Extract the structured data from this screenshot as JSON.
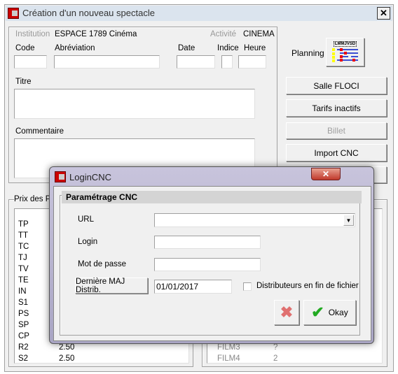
{
  "window": {
    "title": "Création d'un nouveau spectacle",
    "close": "✕"
  },
  "form": {
    "institution_label": "Institution",
    "institution_value": "ESPACE 1789 Cinéma",
    "activite_label": "Activité",
    "activite_value": "CINEMA",
    "code_label": "Code",
    "abreviation_label": "Abréviation",
    "date_label": "Date",
    "indice_label": "Indice",
    "heure_label": "Heure",
    "titre_label": "Titre",
    "commentaire_label": "Commentaire"
  },
  "side": {
    "planning_label": "Planning",
    "planning_days": "LMMJVSD",
    "buttons": [
      "Salle FLOCI",
      "Tarifs inactifs",
      "Billet",
      "Import CNC"
    ]
  },
  "prices": {
    "group_label": "Prix des Pl",
    "items": [
      {
        "code": "TP"
      },
      {
        "code": "TT"
      },
      {
        "code": "TC"
      },
      {
        "code": "TJ"
      },
      {
        "code": "TV"
      },
      {
        "code": "TE"
      },
      {
        "code": "IN"
      },
      {
        "code": "S1"
      },
      {
        "code": "PS"
      },
      {
        "code": "SP"
      },
      {
        "code": "CP"
      },
      {
        "code": "R2",
        "value": "2.50"
      },
      {
        "code": "S2",
        "value": "2.50"
      }
    ]
  },
  "films": {
    "items": [
      {
        "name": "FILM3",
        "value": "?"
      },
      {
        "name": "FILM4",
        "value": "2"
      }
    ]
  },
  "dialog": {
    "title": "LoginCNC",
    "close": "✕",
    "group_label": "Paramétrage CNC",
    "url_label": "URL",
    "url_value": "",
    "login_label": "Login",
    "login_value": "",
    "password_label": "Mot de passe",
    "password_value": "",
    "maj_button": "Dernière MAJ Distrib.",
    "maj_date": "01/01/2017",
    "checkbox_label": "Distributeurs en fin de fichier",
    "checkbox_checked": false,
    "ok_label": "Okay"
  }
}
